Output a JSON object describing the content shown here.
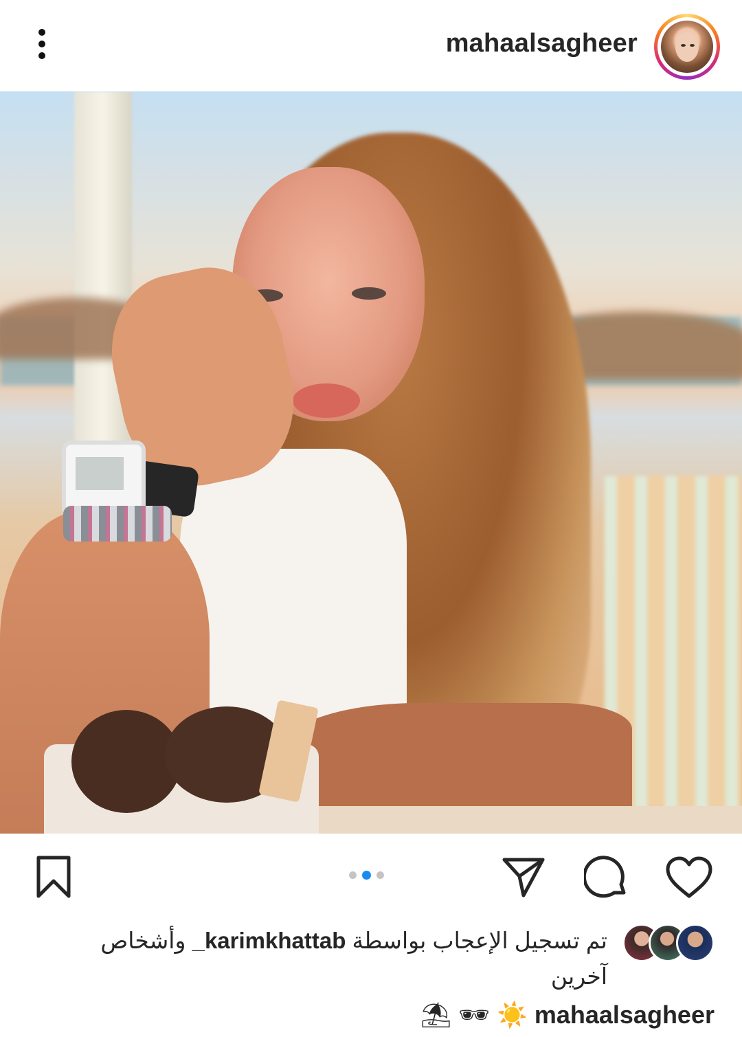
{
  "header": {
    "username": "mahaalsagheer",
    "menu_icon": "more-vertical-icon",
    "avatar_alt": "mahaalsagheer"
  },
  "post": {
    "image_description": "",
    "carousel": {
      "total": 3,
      "current": 2
    },
    "actions": {
      "like_icon": "heart-icon",
      "comment_icon": "comment-icon",
      "share_icon": "send-icon",
      "save_icon": "bookmark-icon"
    }
  },
  "likes": {
    "prefix": "تم تسجيل الإعجاب بواسطة",
    "user": "karimkhattab_",
    "suffix": "وأشخاص آخرين"
  },
  "caption": {
    "username": "mahaalsagheer",
    "text": "⛱ 🕶 ☀️"
  },
  "colors": {
    "accent": "#1a8cf0",
    "text": "#262626"
  }
}
